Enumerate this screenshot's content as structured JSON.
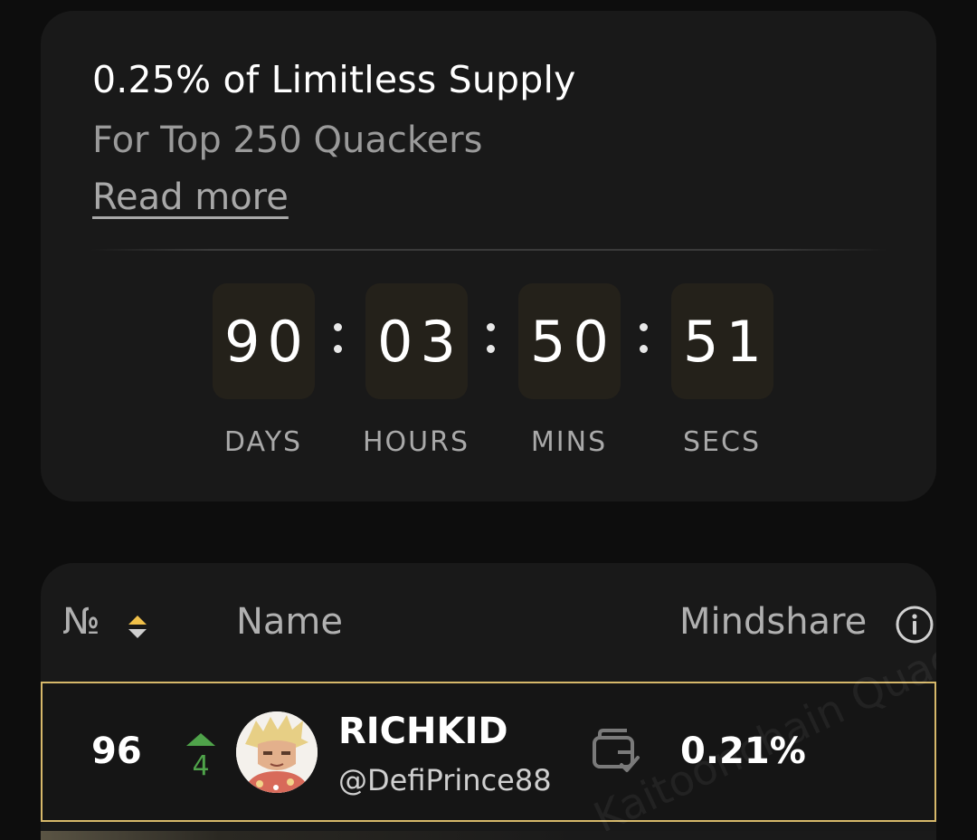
{
  "campaign": {
    "title": "0.25% of Limitless Supply",
    "subtitle": "For Top 250 Quackers",
    "read_more": "Read more"
  },
  "countdown": {
    "days": "90",
    "hours": "03",
    "mins": "50",
    "secs": "51",
    "labels": {
      "days": "DAYS",
      "hours": "HOURS",
      "mins": "MINS",
      "secs": "SECS"
    }
  },
  "leaderboard": {
    "headers": {
      "rank": "№",
      "name": "Name",
      "mindshare": "Mindshare"
    },
    "rows": [
      {
        "rank": "96",
        "rank_change": "4",
        "rank_change_direction": "up",
        "display_name": "RICHKID",
        "username": "@DefiPrince88",
        "mindshare": "0.21%",
        "wallet_connected": true
      }
    ],
    "watermark": "Kaitoonchain Quacks"
  },
  "colors": {
    "background": "#0d0d0d",
    "card": "#191919",
    "timer_box": "#24211a",
    "highlight_border": "#d6b86a",
    "rank_up": "#4fa34a",
    "sort_accent": "#f0c04a"
  },
  "icons": {
    "sort": "sort-icon",
    "info": "info-icon",
    "rank_up": "triangle-up-icon",
    "wallet": "wallet-check-icon"
  }
}
